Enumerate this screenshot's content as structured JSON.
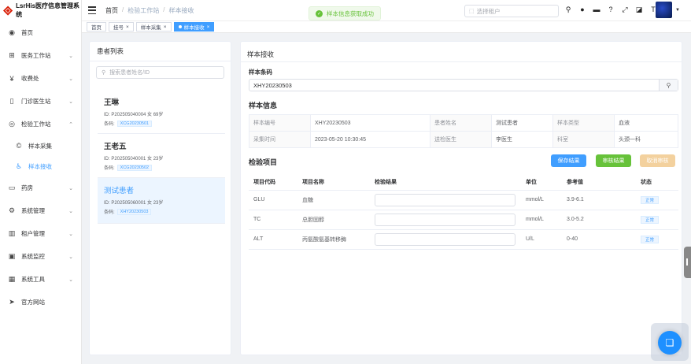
{
  "app": {
    "title": "LsrHis医疗信息管理系统"
  },
  "sidebar": {
    "items": [
      {
        "label": "首页",
        "icon": "dashboard-icon"
      },
      {
        "label": "医务工作站",
        "icon": "hospital-icon"
      },
      {
        "label": "收费处",
        "icon": "yen-icon"
      },
      {
        "label": "门诊医生站",
        "icon": "document-icon"
      },
      {
        "label": "检验工作站",
        "icon": "eye-icon"
      },
      {
        "label": "样本采集",
        "icon": "copyright-icon"
      },
      {
        "label": "样本接收",
        "icon": "accessibility-icon"
      },
      {
        "label": "药房",
        "icon": "box-icon"
      },
      {
        "label": "系统管理",
        "icon": "gear-icon"
      },
      {
        "label": "租户管理",
        "icon": "chart-icon"
      },
      {
        "label": "系统监控",
        "icon": "monitor-icon"
      },
      {
        "label": "系统工具",
        "icon": "grid-icon"
      },
      {
        "label": "官方网站",
        "icon": "send-icon"
      }
    ]
  },
  "header": {
    "breadcrumb": [
      "首页",
      "检验工作站",
      "样本接收"
    ],
    "toast": "样本信息获取成功",
    "tenant_placeholder": "选择租户"
  },
  "tags": [
    {
      "label": "首页"
    },
    {
      "label": "挂号",
      "close": "×"
    },
    {
      "label": "样本采集",
      "close": "×"
    },
    {
      "label": "样本接收",
      "close": "×"
    }
  ],
  "patient_list": {
    "title": "患者列表",
    "search_placeholder": "搜索患者姓名/ID",
    "patients": [
      {
        "name": "王琳",
        "info": "ID: P202505040004  女  69岁",
        "barcode_label": "条码:",
        "barcode": "XCG20230501"
      },
      {
        "name": "王老五",
        "info": "ID: P202505040001  女  23岁",
        "barcode_label": "条码:",
        "barcode": "XCG20230502"
      },
      {
        "name": "测试患者",
        "info": "ID: P202505060001  女  23岁",
        "barcode_label": "条码:",
        "barcode": "XHY20230503"
      }
    ]
  },
  "sample_receive": {
    "title": "样本接收",
    "barcode_label": "样本条码",
    "barcode_value": "XHY20230503",
    "info_title": "样本信息",
    "info_rows": [
      [
        "样本编号",
        "XHY20230503",
        "患者姓名",
        "测试患者",
        "样本类型",
        "血液"
      ],
      [
        "采集时间",
        "2023-05-20 10:30:45",
        "送检医生",
        "李医生",
        "科室",
        "头颈一科"
      ]
    ],
    "items_title": "检验项目",
    "buttons": {
      "save": "保存结果",
      "audit": "审核结果",
      "cancel": "取消审核"
    },
    "columns": [
      "项目代码",
      "项目名称",
      "检验结果",
      "单位",
      "参考值",
      "状态"
    ],
    "rows": [
      {
        "code": "GLU",
        "name": "血糖",
        "result": "",
        "unit": "mmol/L",
        "ref": "3.9-6.1",
        "status": "正常"
      },
      {
        "code": "TC",
        "name": "总胆固醇",
        "result": "",
        "unit": "mmol/L",
        "ref": "3.0-5.2",
        "status": "正常"
      },
      {
        "code": "ALT",
        "name": "丙氨酸氨基转移酶",
        "result": "",
        "unit": "U/L",
        "ref": "0-40",
        "status": "正常"
      }
    ]
  },
  "colors": {
    "primary": "#409eff",
    "success": "#67c23a",
    "warning_light": "#f3d19e"
  }
}
